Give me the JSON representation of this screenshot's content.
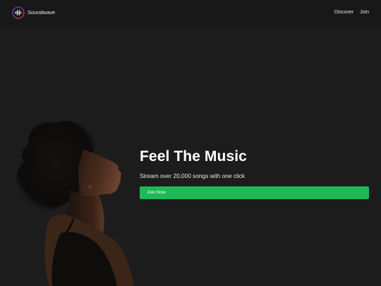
{
  "navbar": {
    "brand": {
      "name": "Soundwave",
      "logo_icon": "soundwave-logo-icon"
    },
    "links": [
      {
        "label": "Discover"
      },
      {
        "label": "Join"
      }
    ]
  },
  "hero": {
    "title": "Feel The Music",
    "subtitle": "Stream over 20,000 songs with one click",
    "cta_label": "Join Now",
    "image": "woman-listening-photo"
  },
  "colors": {
    "background": "#1c1c1c",
    "navbar": "#191818",
    "accent": "#1db954",
    "logo_gradient": [
      "#6a3cff",
      "#ff2d8a"
    ]
  }
}
